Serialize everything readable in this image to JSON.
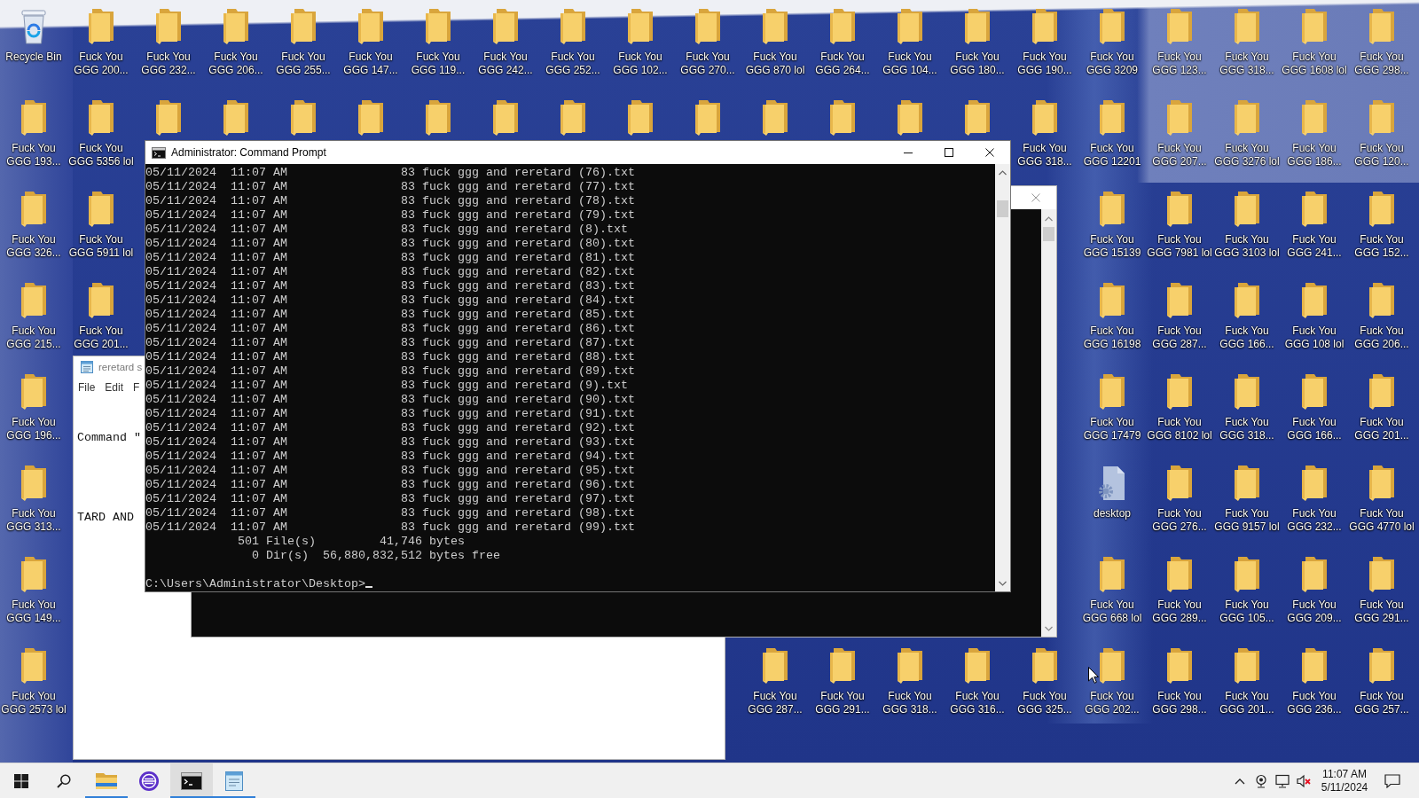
{
  "desktop": {
    "icon_rows": [
      {
        "left": [
          {
            "kind": "recycle-bin",
            "label": "Recycle Bin"
          },
          {
            "kind": "folder",
            "label": "Fuck You\nGGG 200..."
          },
          {
            "kind": "folder",
            "label": "Fuck You\nGGG 232..."
          },
          {
            "kind": "folder",
            "label": "Fuck You\nGGG 206..."
          },
          {
            "kind": "folder",
            "label": "Fuck You\nGGG 255..."
          },
          {
            "kind": "folder",
            "label": "Fuck You\nGGG 147..."
          },
          {
            "kind": "folder",
            "label": "Fuck You\nGGG 119..."
          },
          {
            "kind": "folder",
            "label": "Fuck You\nGGG 242..."
          },
          {
            "kind": "folder",
            "label": "Fuck You\nGGG 252..."
          },
          {
            "kind": "folder",
            "label": "Fuck You\nGGG 102..."
          },
          {
            "kind": "folder",
            "label": "Fuck You\nGGG 270..."
          },
          {
            "kind": "folder",
            "label": "Fuck You\nGGG 870 lol"
          },
          {
            "kind": "folder",
            "label": "Fuck You\nGGG 264..."
          },
          {
            "kind": "folder",
            "label": "Fuck You\nGGG 104..."
          },
          {
            "kind": "folder",
            "label": "Fuck You\nGGG 180..."
          },
          {
            "kind": "folder",
            "label": "Fuck You\nGGG 190..."
          },
          {
            "kind": "folder",
            "label": "Fuck You\nGGG 3209"
          },
          {
            "kind": "folder",
            "label": "Fuck You\nGGG 123..."
          },
          {
            "kind": "folder",
            "label": "Fuck You\nGGG 318..."
          },
          {
            "kind": "folder",
            "label": "Fuck You\nGGG 1608 lol"
          },
          {
            "kind": "folder",
            "label": "Fuck You\nGGG 298..."
          }
        ]
      },
      {
        "left": [
          {
            "kind": "folder",
            "label": "Fuck You\nGGG 193..."
          },
          {
            "kind": "folder",
            "label": "Fuck You\nGGG 5356 lol"
          },
          {
            "kind": "folder"
          },
          {
            "kind": "folder"
          },
          {
            "kind": "folder"
          },
          {
            "kind": "folder"
          },
          {
            "kind": "folder"
          },
          {
            "kind": "folder"
          },
          {
            "kind": "folder"
          },
          {
            "kind": "folder"
          },
          {
            "kind": "folder"
          },
          {
            "kind": "folder"
          },
          {
            "kind": "folder"
          },
          {
            "kind": "folder"
          },
          {
            "kind": "folder"
          }
        ],
        "right": [
          {
            "kind": "folder",
            "label": "Fuck You\nGGG 318..."
          },
          {
            "kind": "folder",
            "label": "Fuck You\nGGG 12201"
          },
          {
            "kind": "folder",
            "label": "Fuck You\nGGG 207..."
          },
          {
            "kind": "folder",
            "label": "Fuck You\nGGG 3276 lol"
          },
          {
            "kind": "folder",
            "label": "Fuck You\nGGG 186..."
          },
          {
            "kind": "folder",
            "label": "Fuck You\nGGG 120..."
          }
        ]
      },
      {
        "left": [
          {
            "kind": "folder",
            "label": "Fuck You\nGGG 326..."
          },
          {
            "kind": "folder",
            "label": "Fuck You\nGGG 5911 lol"
          }
        ],
        "right": [
          {
            "kind": "folder",
            "label": "Fuck You\nGGG 15139"
          },
          {
            "kind": "folder",
            "label": "Fuck You\nGGG 7981 lol"
          },
          {
            "kind": "folder",
            "label": "Fuck You\nGGG 3103 lol"
          },
          {
            "kind": "folder",
            "label": "Fuck You\nGGG 241..."
          },
          {
            "kind": "folder",
            "label": "Fuck You\nGGG 152..."
          }
        ]
      },
      {
        "left": [
          {
            "kind": "folder",
            "label": "Fuck You\nGGG 215..."
          },
          {
            "kind": "folder",
            "label": "Fuck You\nGGG 201..."
          }
        ],
        "right": [
          {
            "kind": "folder",
            "label": "Fuck You\nGGG 16198"
          },
          {
            "kind": "folder",
            "label": "Fuck You\nGGG 287..."
          },
          {
            "kind": "folder",
            "label": "Fuck You\nGGG 166..."
          },
          {
            "kind": "folder",
            "label": "Fuck You\nGGG 108 lol"
          },
          {
            "kind": "folder",
            "label": "Fuck You\nGGG 206..."
          }
        ]
      },
      {
        "left": [
          {
            "kind": "folder",
            "label": "Fuck You\nGGG 196..."
          }
        ],
        "right": [
          {
            "kind": "folder",
            "label": "Fuck You\nGGG 17479"
          },
          {
            "kind": "folder",
            "label": "Fuck You\nGGG 8102 lol"
          },
          {
            "kind": "folder",
            "label": "Fuck You\nGGG 318..."
          },
          {
            "kind": "folder",
            "label": "Fuck You\nGGG 166..."
          },
          {
            "kind": "folder",
            "label": "Fuck You\nGGG 201..."
          }
        ]
      },
      {
        "left": [
          {
            "kind": "folder",
            "label": "Fuck You\nGGG 313..."
          }
        ],
        "right": [
          {
            "kind": "file",
            "label": "desktop"
          },
          {
            "kind": "folder",
            "label": "Fuck You\nGGG 276..."
          },
          {
            "kind": "folder",
            "label": "Fuck You\nGGG 9157 lol"
          },
          {
            "kind": "folder",
            "label": "Fuck You\nGGG 232..."
          },
          {
            "kind": "folder",
            "label": "Fuck You\nGGG 4770 lol"
          }
        ]
      },
      {
        "left": [
          {
            "kind": "folder",
            "label": "Fuck You\nGGG 149..."
          }
        ],
        "right": [
          {
            "kind": "folder",
            "label": "Fuck You\nGGG 668 lol"
          },
          {
            "kind": "folder",
            "label": "Fuck You\nGGG 289..."
          },
          {
            "kind": "folder",
            "label": "Fuck You\nGGG 105..."
          },
          {
            "kind": "folder",
            "label": "Fuck You\nGGG 209..."
          },
          {
            "kind": "folder",
            "label": "Fuck You\nGGG 291..."
          }
        ]
      },
      {
        "left": [
          {
            "kind": "folder",
            "label": "Fuck You\nGGG 2573 lol"
          }
        ],
        "right": [
          {
            "kind": "folder",
            "label": "Fuck You\nGGG 287..."
          },
          {
            "kind": "folder",
            "label": "Fuck You\nGGG 291..."
          },
          {
            "kind": "folder",
            "label": "Fuck You\nGGG 318..."
          },
          {
            "kind": "folder",
            "label": "Fuck You\nGGG 316..."
          },
          {
            "kind": "folder",
            "label": "Fuck You\nGGG 325..."
          },
          {
            "kind": "folder",
            "label": "Fuck You\nGGG 202..."
          },
          {
            "kind": "folder",
            "label": "Fuck You\nGGG 298..."
          },
          {
            "kind": "folder",
            "label": "Fuck You\nGGG 201..."
          },
          {
            "kind": "folder",
            "label": "Fuck You\nGGG 236..."
          },
          {
            "kind": "folder",
            "label": "Fuck You\nGGG 257..."
          }
        ]
      }
    ]
  },
  "notepad": {
    "title": "reretard s",
    "menu": [
      "File",
      "Edit",
      "F"
    ],
    "lines": [
      "Command \"",
      "TARD AND"
    ]
  },
  "console": {
    "title": "Administrator: Command Prompt",
    "lines": [
      "05/11/2024  11:07 AM                83 fuck ggg and reretard (76).txt",
      "05/11/2024  11:07 AM                83 fuck ggg and reretard (77).txt",
      "05/11/2024  11:07 AM                83 fuck ggg and reretard (78).txt",
      "05/11/2024  11:07 AM                83 fuck ggg and reretard (79).txt",
      "05/11/2024  11:07 AM                83 fuck ggg and reretard (8).txt",
      "05/11/2024  11:07 AM                83 fuck ggg and reretard (80).txt",
      "05/11/2024  11:07 AM                83 fuck ggg and reretard (81).txt",
      "05/11/2024  11:07 AM                83 fuck ggg and reretard (82).txt",
      "05/11/2024  11:07 AM                83 fuck ggg and reretard (83).txt",
      "05/11/2024  11:07 AM                83 fuck ggg and reretard (84).txt",
      "05/11/2024  11:07 AM                83 fuck ggg and reretard (85).txt",
      "05/11/2024  11:07 AM                83 fuck ggg and reretard (86).txt",
      "05/11/2024  11:07 AM                83 fuck ggg and reretard (87).txt",
      "05/11/2024  11:07 AM                83 fuck ggg and reretard (88).txt",
      "05/11/2024  11:07 AM                83 fuck ggg and reretard (89).txt",
      "05/11/2024  11:07 AM                83 fuck ggg and reretard (9).txt",
      "05/11/2024  11:07 AM                83 fuck ggg and reretard (90).txt",
      "05/11/2024  11:07 AM                83 fuck ggg and reretard (91).txt",
      "05/11/2024  11:07 AM                83 fuck ggg and reretard (92).txt",
      "05/11/2024  11:07 AM                83 fuck ggg and reretard (93).txt",
      "05/11/2024  11:07 AM                83 fuck ggg and reretard (94).txt",
      "05/11/2024  11:07 AM                83 fuck ggg and reretard (95).txt",
      "05/11/2024  11:07 AM                83 fuck ggg and reretard (96).txt",
      "05/11/2024  11:07 AM                83 fuck ggg and reretard (97).txt",
      "05/11/2024  11:07 AM                83 fuck ggg and reretard (98).txt",
      "05/11/2024  11:07 AM                83 fuck ggg and reretard (99).txt",
      "             501 File(s)         41,746 bytes",
      "               0 Dir(s)  56,880,832,512 bytes free"
    ],
    "prompt": "C:\\Users\\Administrator\\Desktop>"
  },
  "taskbar": {
    "apps": [
      {
        "kind": "folder",
        "running": true,
        "active": false
      },
      {
        "kind": "app",
        "running": false,
        "active": false
      },
      {
        "kind": "console",
        "running": true,
        "active": true
      },
      {
        "kind": "notepad",
        "running": true,
        "active": false
      }
    ],
    "volume": {
      "muted": true
    },
    "clock": {
      "time": "11:07 AM",
      "date": "5/11/2024"
    }
  }
}
